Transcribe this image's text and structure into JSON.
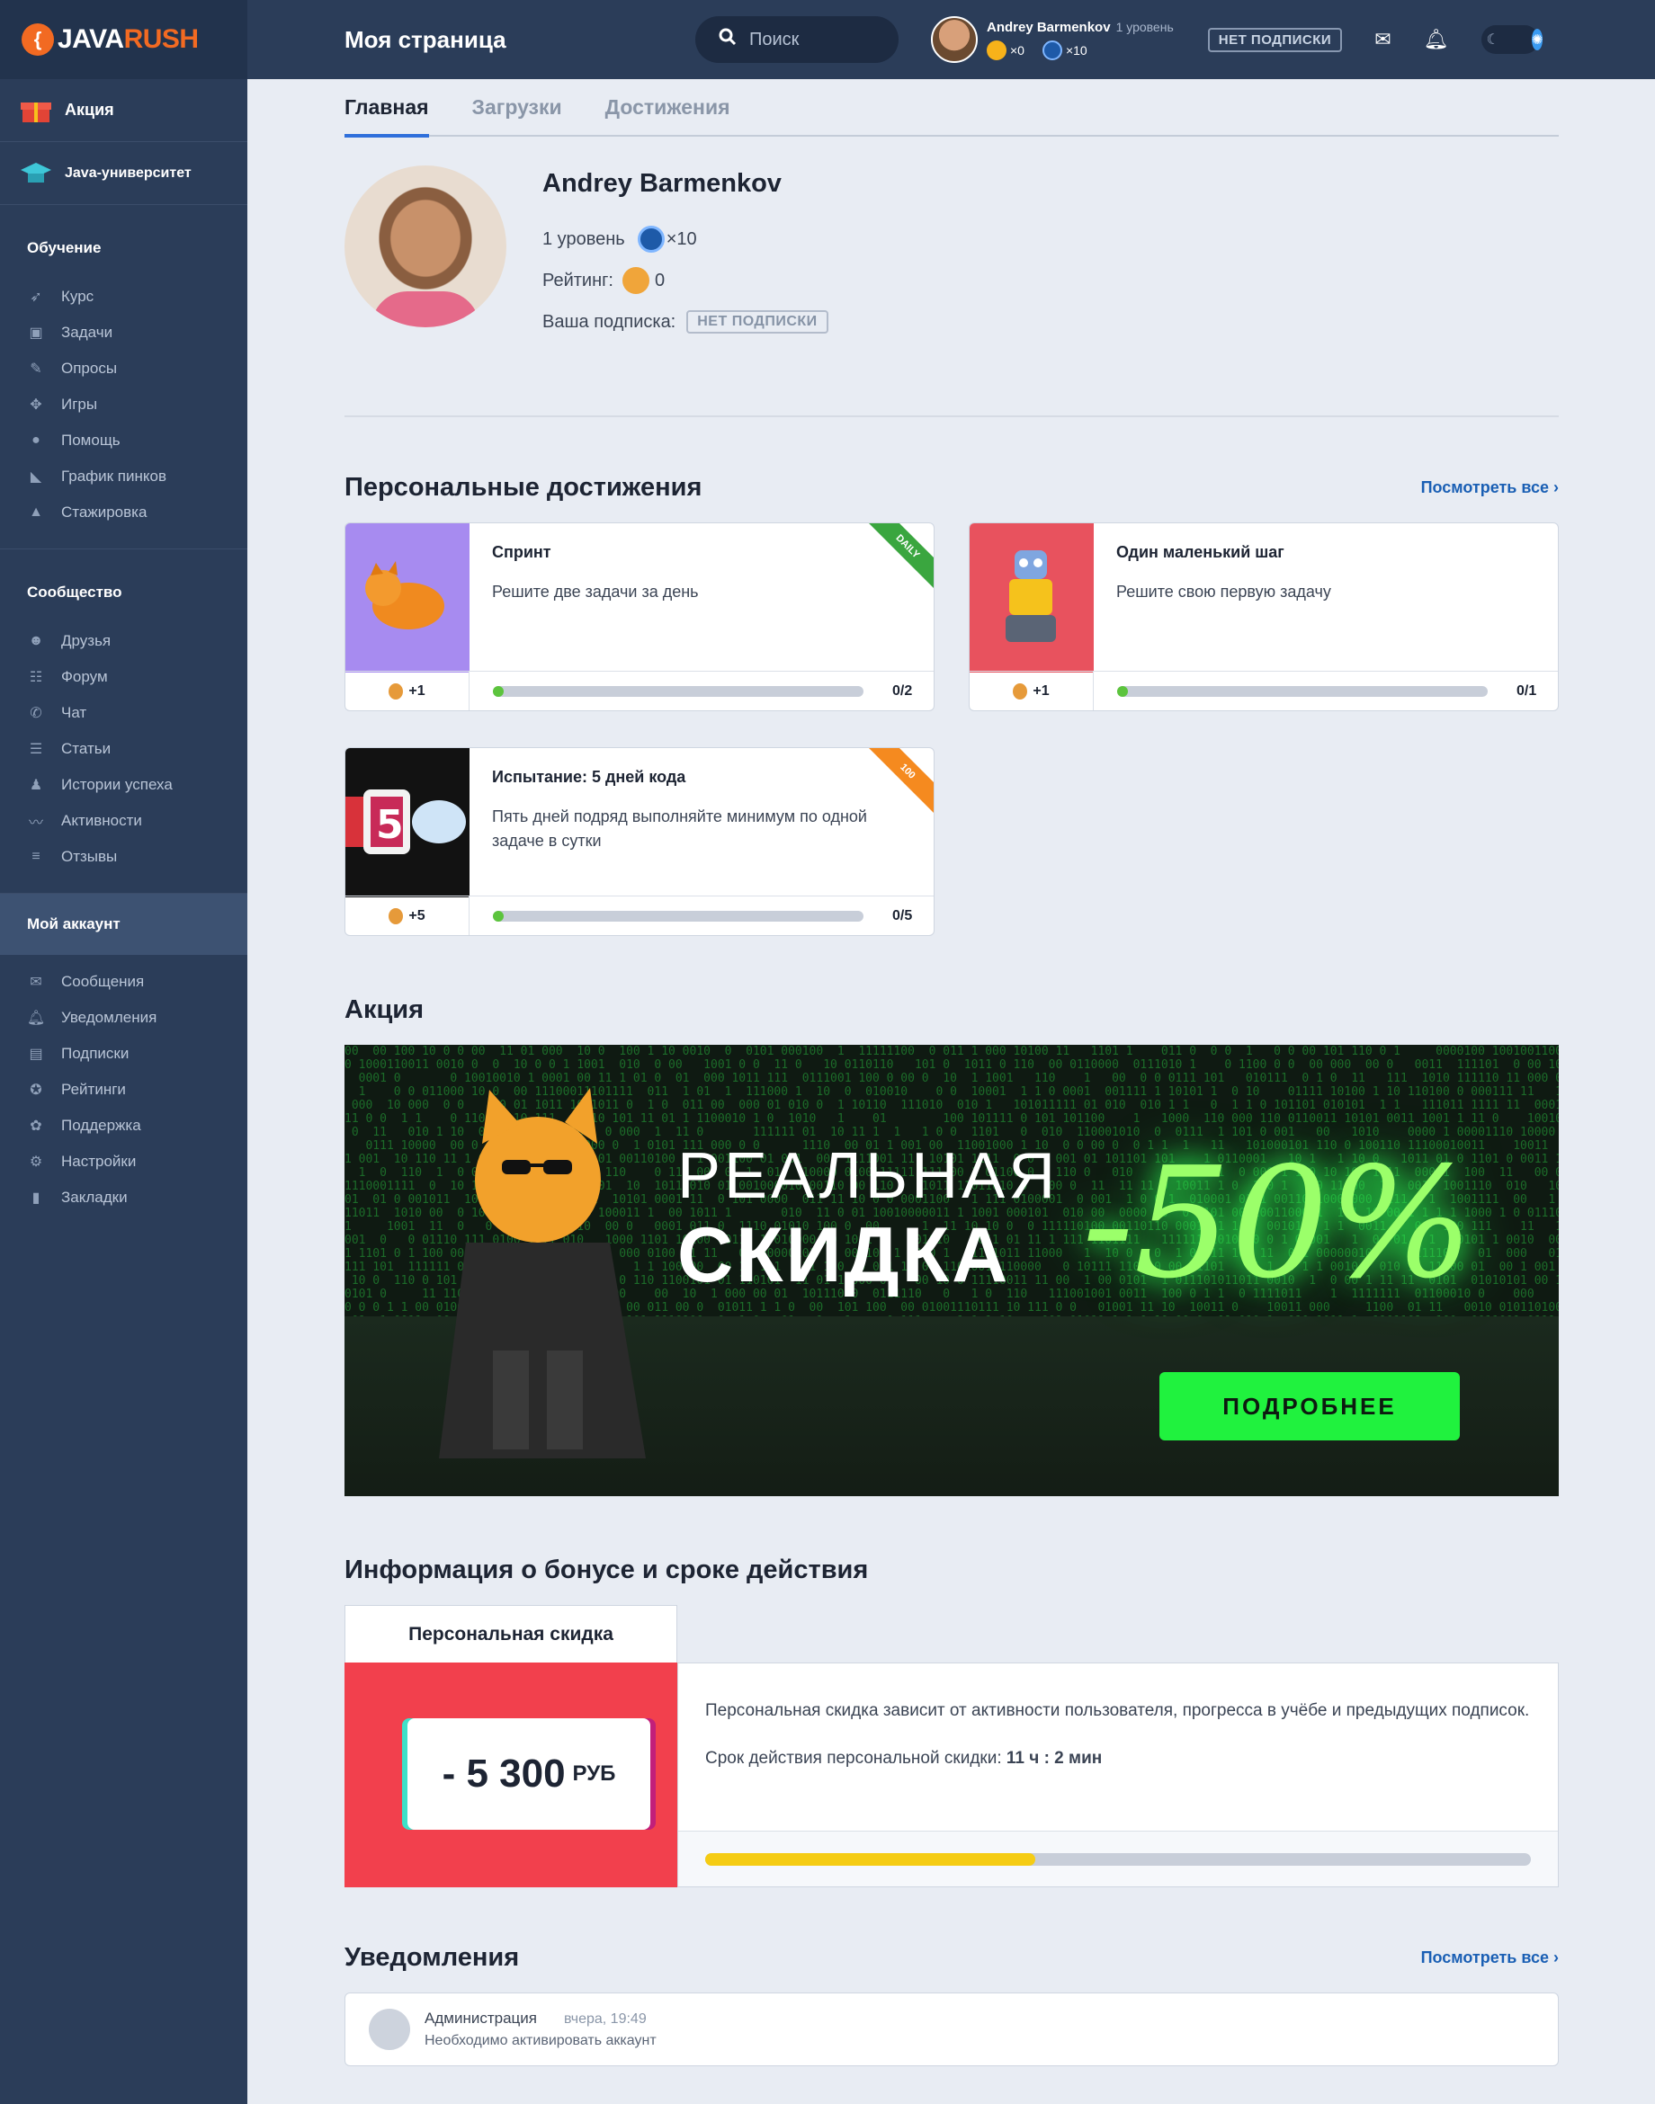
{
  "brand": {
    "java": "JAVA",
    "rush": "RUSH"
  },
  "header": {
    "page_title": "Моя страница",
    "search_placeholder": "Поиск",
    "user_name": "Andrey Barmenkov",
    "user_level": "1 уровень",
    "coins": "×0",
    "stars": "×10",
    "subscription": "НЕТ ПОДПИСКИ"
  },
  "sidebar": {
    "promo": [
      {
        "label": "Акция",
        "icon": "gift-icon"
      },
      {
        "label": "Java-университет",
        "icon": "graduation-cap-icon"
      }
    ],
    "sections": [
      {
        "title": "Обучение",
        "items": [
          {
            "label": "Курс",
            "icon": "rocket-icon"
          },
          {
            "label": "Задачи",
            "icon": "tasks-icon"
          },
          {
            "label": "Опросы",
            "icon": "survey-icon"
          },
          {
            "label": "Игры",
            "icon": "gamepad-icon"
          },
          {
            "label": "Помощь",
            "icon": "help-icon"
          },
          {
            "label": "График пинков",
            "icon": "kick-icon"
          },
          {
            "label": "Стажировка",
            "icon": "internship-icon"
          }
        ]
      },
      {
        "title": "Сообщество",
        "items": [
          {
            "label": "Друзья",
            "icon": "friends-icon"
          },
          {
            "label": "Форум",
            "icon": "forum-icon"
          },
          {
            "label": "Чат",
            "icon": "chat-icon"
          },
          {
            "label": "Статьи",
            "icon": "articles-icon"
          },
          {
            "label": "Истории успеха",
            "icon": "success-icon"
          },
          {
            "label": "Активности",
            "icon": "activity-icon"
          },
          {
            "label": "Отзывы",
            "icon": "reviews-icon"
          }
        ]
      },
      {
        "title": "Мой аккаунт",
        "items": [
          {
            "label": "Сообщения",
            "icon": "mail-icon"
          },
          {
            "label": "Уведомления",
            "icon": "bell-icon"
          },
          {
            "label": "Подписки",
            "icon": "subscription-icon"
          },
          {
            "label": "Рейтинги",
            "icon": "medal-icon"
          },
          {
            "label": "Поддержка",
            "icon": "support-icon"
          },
          {
            "label": "Настройки",
            "icon": "gear-icon"
          },
          {
            "label": "Закладки",
            "icon": "bookmark-icon"
          }
        ]
      }
    ]
  },
  "tabs": [
    "Главная",
    "Загрузки",
    "Достижения"
  ],
  "profile": {
    "name": "Andrey Barmenkov",
    "level": "1 уровень",
    "stars": "×10",
    "rating_label": "Рейтинг:",
    "rating": "0",
    "subscription_label": "Ваша подписка:",
    "subscription": "НЕТ ПОДПИСКИ"
  },
  "achievements": {
    "title": "Персональные достижения",
    "see_all": "Посмотреть все",
    "items": [
      {
        "title": "Спринт",
        "desc": "Решите две задачи за день",
        "reward": "+1",
        "progress": "0/2",
        "ribbon": "DAILY",
        "ribbon_color": "#3aa63f",
        "bg": "#a78bf0"
      },
      {
        "title": "Один маленький шаг",
        "desc": "Решите свою первую задачу",
        "reward": "+1",
        "progress": "0/1",
        "ribbon": "",
        "ribbon_color": "",
        "bg": "#e8525e"
      },
      {
        "title": "Испытание: 5 дней кода",
        "desc": "Пять дней подряд выполняйте минимум по одной задаче в сутки",
        "reward": "+5",
        "progress": "0/5",
        "ribbon": "100",
        "ribbon_color": "#f58a1f",
        "bg": "#121212"
      }
    ]
  },
  "promo": {
    "title": "Акция",
    "line1": "РЕАЛЬНАЯ",
    "line2": "СКИДКА",
    "discount": "-50%",
    "button": "ПОДРОБНЕЕ"
  },
  "bonus": {
    "title": "Информация о бонусе и сроке действия",
    "tab": "Персональная скидка",
    "amount": "- 5 300",
    "currency": "РУБ",
    "text": "Персональная скидка зависит от активности пользователя, прогресса в учёбе и предыдущих подписок.",
    "expiry_label": "Срок действия персональной скидки:",
    "expiry_value": "11 ч : 2 мин",
    "progress": 0.4
  },
  "notifications": {
    "title": "Уведомления",
    "see_all": "Посмотреть все",
    "items": [
      {
        "from": "Администрация",
        "time": "вчера, 19:49",
        "message": "Необходимо активировать аккаунт"
      }
    ]
  }
}
